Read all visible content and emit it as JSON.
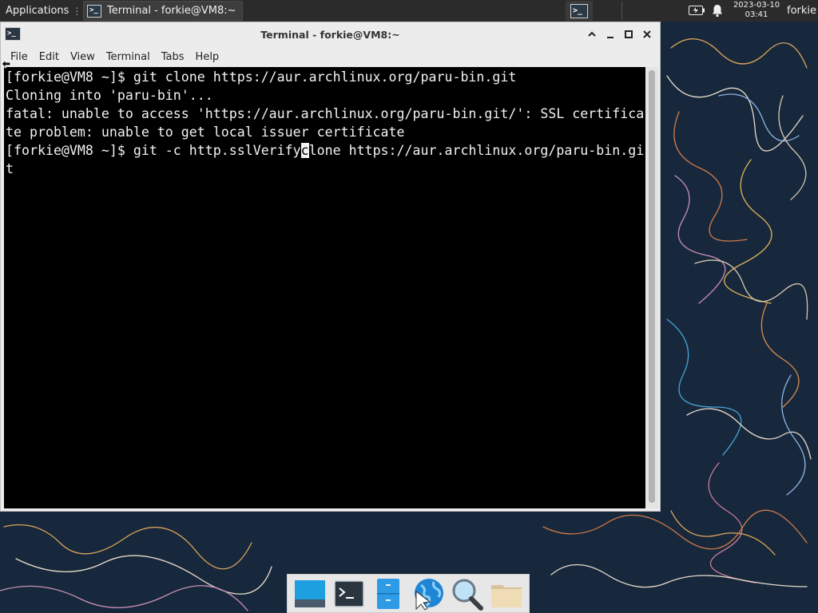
{
  "top_panel": {
    "applications_label": "Applications",
    "taskbar_window_title": "Terminal - forkie@VM8:~",
    "clock_date": "2023-03-10",
    "clock_time": "03:41",
    "username": "forkie"
  },
  "window": {
    "title": "Terminal - forkie@VM8:~",
    "menu": [
      "File",
      "Edit",
      "View",
      "Terminal",
      "Tabs",
      "Help"
    ]
  },
  "terminal": {
    "lines": [
      "[forkie@VM8 ~]$ git clone https://aur.archlinux.org/paru-bin.git",
      "Cloning into 'paru-bin'...",
      "fatal: unable to access 'https://aur.archlinux.org/paru-bin.git/': SSL certifica",
      "te problem: unable to get local issuer certificate"
    ],
    "current_command_before_cursor": "[forkie@VM8 ~]$ git -c http.sslVerify",
    "cursor_char": "c",
    "current_command_after_cursor": "lone https://aur.archlinux.org/paru-bin.gi",
    "current_command_wrap": "t"
  },
  "dock": {
    "items": [
      "show-desktop",
      "terminal",
      "file-manager",
      "web-browser",
      "app-finder",
      "home-folder"
    ]
  },
  "colors": {
    "terminal_bg": "#000000",
    "terminal_fg": "#f2f2f2",
    "panel_bg": "#2b2b2b",
    "desktop_bg": "#17283c",
    "window_chrome": "#ececec"
  }
}
